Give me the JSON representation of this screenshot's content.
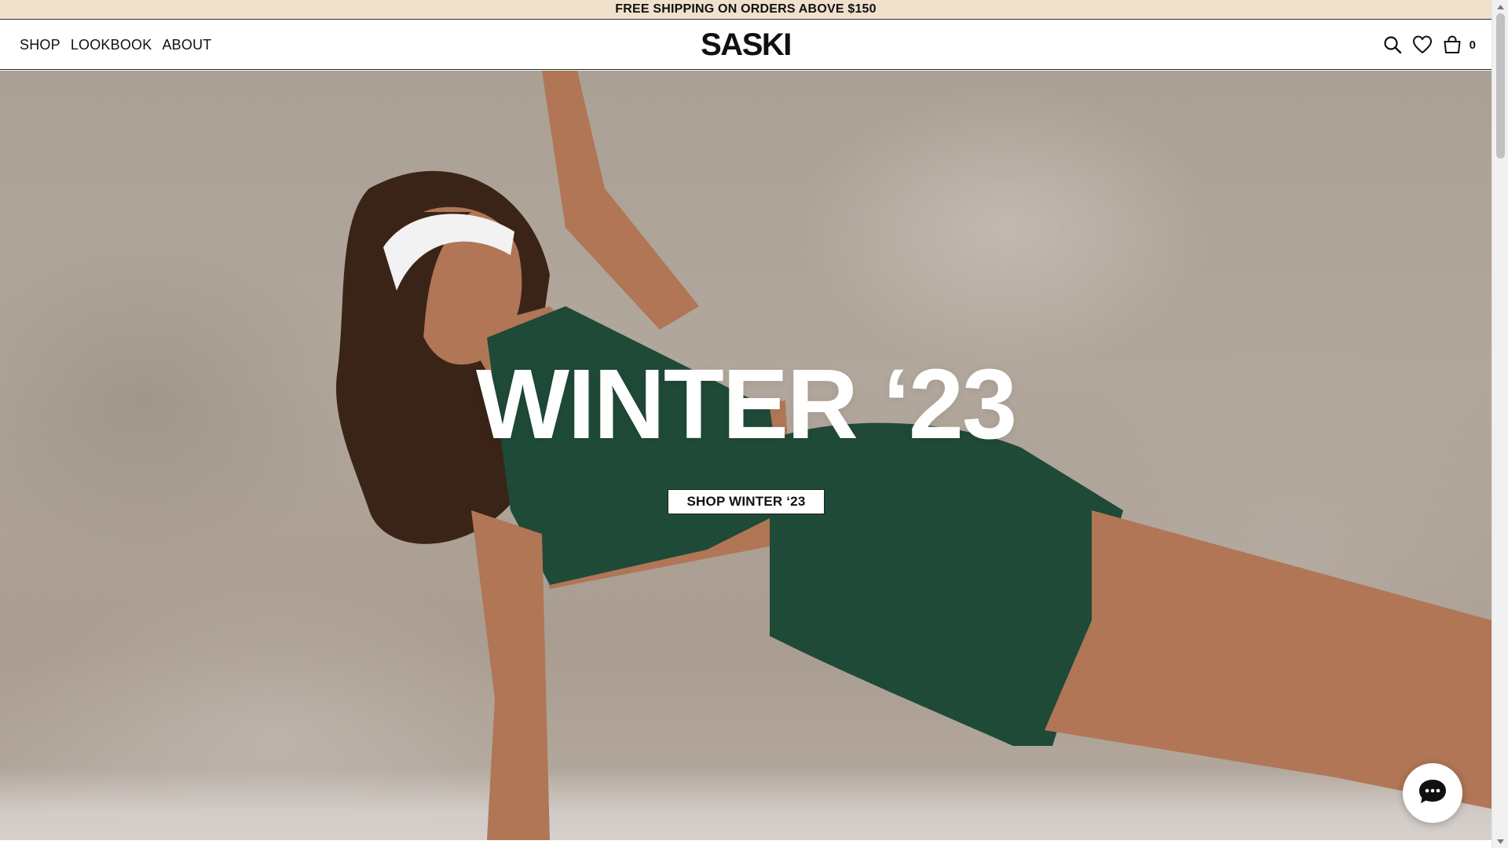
{
  "announcement": {
    "text": "FREE SHIPPING ON ORDERS ABOVE $150"
  },
  "header": {
    "nav": [
      {
        "label": "SHOP"
      },
      {
        "label": "LOOKBOOK"
      },
      {
        "label": "ABOUT"
      }
    ],
    "logo": "SASKI",
    "icons": [
      "search-icon",
      "heart-icon",
      "bag-icon"
    ],
    "cart_count": "0"
  },
  "hero": {
    "title": "WINTER ‘23",
    "cta_label": "SHOP WINTER ‘23",
    "colors": {
      "outfit": "#1f4a38",
      "skin": "#b07656",
      "hair": "#3a2418",
      "headband": "#f2f2f2",
      "wall": "#aaa095"
    }
  },
  "chat": {
    "icon": "chat-bubble-icon"
  },
  "colors": {
    "announcement_bg": "#efe1cc",
    "text": "#111111"
  }
}
